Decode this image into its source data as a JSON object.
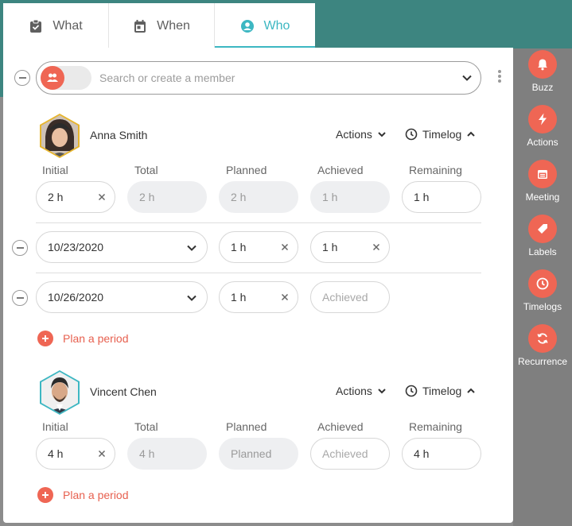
{
  "tabs": [
    {
      "label": "What",
      "icon": "clipboard-check-icon",
      "active": false
    },
    {
      "label": "When",
      "icon": "calendar-icon",
      "active": false
    },
    {
      "label": "Who",
      "icon": "user-circle-icon",
      "active": true
    }
  ],
  "search": {
    "placeholder": "Search or create a member"
  },
  "columns": [
    "Initial",
    "Total",
    "Planned",
    "Achieved",
    "Remaining"
  ],
  "members": [
    {
      "name": "Anna Smith",
      "actions_label": "Actions",
      "timelog_label": "Timelog",
      "initial": "2 h",
      "total": "2 h",
      "planned": "2 h",
      "achieved": "1 h",
      "remaining": "1 h",
      "periods": [
        {
          "date": "10/23/2020",
          "planned": "1 h",
          "achieved": "1 h"
        },
        {
          "date": "10/26/2020",
          "planned": "1 h",
          "achieved_placeholder": "Achieved"
        }
      ],
      "plan_label": "Plan a period"
    },
    {
      "name": "Vincent Chen",
      "actions_label": "Actions",
      "timelog_label": "Timelog",
      "initial": "4 h",
      "total": "4 h",
      "planned_placeholder": "Planned",
      "achieved_placeholder": "Achieved",
      "remaining": "4 h",
      "plan_label": "Plan a period"
    }
  ],
  "side_menu": [
    {
      "label": "Buzz",
      "icon": "bell-icon"
    },
    {
      "label": "Actions",
      "icon": "bolt-icon"
    },
    {
      "label": "Meeting",
      "icon": "meeting-calendar-icon"
    },
    {
      "label": "Labels",
      "icon": "label-tag-icon"
    },
    {
      "label": "Timelogs",
      "icon": "clock-icon"
    },
    {
      "label": "Recurrence",
      "icon": "recurrence-sync-icon"
    }
  ],
  "colors": {
    "accent": "#3db7c2",
    "brand": "#ef6654",
    "teal_header": "#3d8580",
    "avatar_border_anna": "#e7b52c",
    "avatar_border_vincent": "#3db7c2"
  }
}
